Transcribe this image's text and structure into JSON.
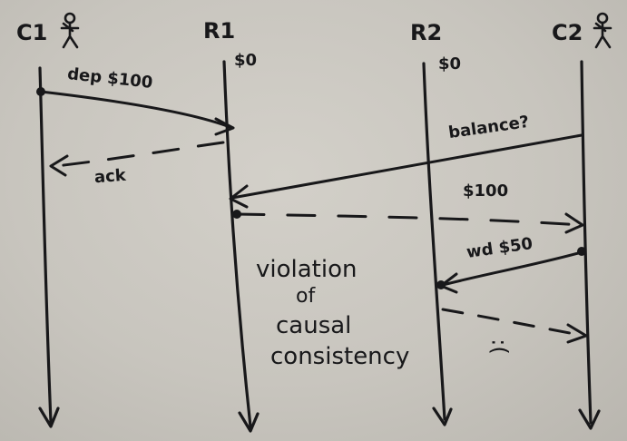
{
  "processes": {
    "c1": "C1",
    "r1": "R1",
    "r2": "R2",
    "c2": "C2"
  },
  "replica_balances": {
    "r1": "$0",
    "r2": "$0"
  },
  "messages": {
    "deposit": "dep $100",
    "ack": "ack",
    "balance_query": "balance?",
    "balance_reply": "$100",
    "withdraw": "wd $50"
  },
  "annotation": {
    "line1": "violation",
    "line2": "of",
    "line3": "causal",
    "line4": "consistency"
  },
  "frown": ":("
}
